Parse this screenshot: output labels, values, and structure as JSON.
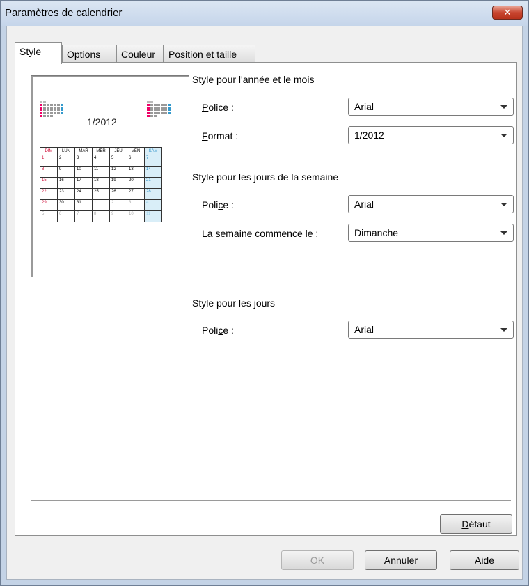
{
  "window": {
    "title": "Paramètres de calendrier",
    "close_glyph": "✕"
  },
  "tabs": [
    "Style",
    "Options",
    "Couleur",
    "Position et taille"
  ],
  "preview": {
    "month_label": "1/2012",
    "weekdays": [
      "DIM",
      "LUN",
      "MAR",
      "MER",
      "JEU",
      "VEN",
      "SAM"
    ],
    "weeks": [
      [
        "1",
        "2",
        "3",
        "4",
        "5",
        "6",
        "7"
      ],
      [
        "8",
        "9",
        "10",
        "11",
        "12",
        "13",
        "14"
      ],
      [
        "15",
        "16",
        "17",
        "18",
        "19",
        "20",
        "21"
      ],
      [
        "22",
        "23",
        "24",
        "25",
        "26",
        "27",
        "28"
      ],
      [
        "29",
        "30",
        "31",
        "1",
        "2",
        "3",
        "4"
      ],
      [
        "5",
        "6",
        "7",
        "8",
        "9",
        "10",
        "11"
      ]
    ]
  },
  "year_month": {
    "title": "Style pour l'année et le mois",
    "police_label_u": "P",
    "police_label_rest": "olice :",
    "police_value": "Arial",
    "format_label_u": "F",
    "format_label_rest": "ormat :",
    "format_value": "1/2012"
  },
  "weekdays_style": {
    "title": "Style pour les jours de la semaine",
    "police_label_a": "Poli",
    "police_label_u": "c",
    "police_label_b": "e :",
    "police_value": "Arial",
    "start_label_u": "L",
    "start_label_rest": "a semaine commence le :",
    "start_value": "Dimanche"
  },
  "days_style": {
    "title": "Style pour les jours",
    "police_label_a": "Poli",
    "police_label_u": "c",
    "police_label_b": "e :",
    "police_value": "Arial"
  },
  "buttons": {
    "default_u": "D",
    "default_rest": "éfaut",
    "ok": "OK",
    "cancel": "Annuler",
    "help": "Aide"
  },
  "colors": {
    "sunday": "#d0103a",
    "saturday_bg": "#d9eef8",
    "saturday_text": "#2a90c8"
  }
}
